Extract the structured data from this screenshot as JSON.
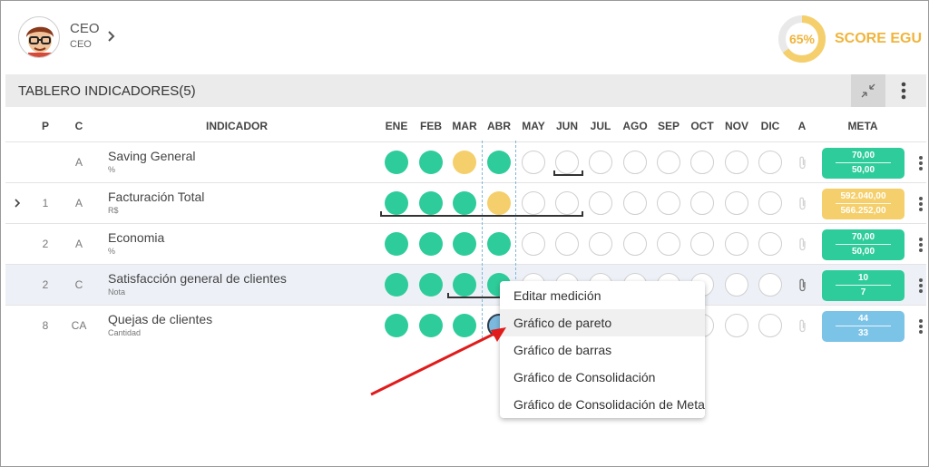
{
  "header": {
    "user_name": "CEO",
    "user_role": "CEO",
    "score_percent": "65%",
    "score_label": "SCORE EGU",
    "score_value": 0.65
  },
  "board": {
    "title": "TABLERO INDICADORES(5)",
    "columns": {
      "p": "P",
      "c": "C",
      "indicator": "INDICADOR",
      "months": [
        "ENE",
        "FEB",
        "MAR",
        "ABR",
        "MAY",
        "JUN",
        "JUL",
        "AGO",
        "SEP",
        "OCT",
        "NOV",
        "DIC"
      ],
      "a": "A",
      "meta": "META"
    },
    "rows": [
      {
        "p": "",
        "c": "A",
        "name": "Saving General",
        "unit": "%",
        "status": [
          "green",
          "green",
          "yellow",
          "green",
          "empty",
          "empty",
          "empty",
          "empty",
          "empty",
          "empty",
          "empty",
          "empty"
        ],
        "meta_top": "70,00",
        "meta_bottom": "50,00",
        "meta_color": "green"
      },
      {
        "p": "1",
        "c": "A",
        "name": "Facturación Total",
        "unit": "R$",
        "status": [
          "green",
          "green",
          "green",
          "yellow",
          "empty",
          "empty",
          "empty",
          "empty",
          "empty",
          "empty",
          "empty",
          "empty"
        ],
        "meta_top": "592.040,00",
        "meta_bottom": "566.252,00",
        "meta_color": "yellow"
      },
      {
        "p": "2",
        "c": "A",
        "name": "Economia",
        "unit": "%",
        "status": [
          "green",
          "green",
          "green",
          "green",
          "empty",
          "empty",
          "empty",
          "empty",
          "empty",
          "empty",
          "empty",
          "empty"
        ],
        "meta_top": "70,00",
        "meta_bottom": "50,00",
        "meta_color": "green"
      },
      {
        "p": "2",
        "c": "C",
        "name": "Satisfacción general de clientes",
        "unit": "Nota",
        "status": [
          "green",
          "green",
          "green",
          "green",
          "empty",
          "empty",
          "empty",
          "empty",
          "empty",
          "empty",
          "empty",
          "empty"
        ],
        "meta_top": "10",
        "meta_bottom": "7",
        "meta_color": "green"
      },
      {
        "p": "8",
        "c": "CA",
        "name": "Quejas de clientes",
        "unit": "Cantidad",
        "status": [
          "green",
          "green",
          "green",
          "blue",
          "empty",
          "empty",
          "empty",
          "empty",
          "empty",
          "empty",
          "empty",
          "empty"
        ],
        "meta_top": "44",
        "meta_bottom": "33",
        "meta_color": "blue"
      }
    ]
  },
  "context_menu": {
    "items": [
      "Editar medición",
      "Gráfico de pareto",
      "Gráfico de barras",
      "Gráfico de Consolidación",
      "Gráfico de Consolidación de Meta"
    ],
    "highlighted": "Gráfico de pareto"
  },
  "colors": {
    "green": "#2ecc9a",
    "yellow": "#f5cf6b",
    "blue": "#7cc3e8",
    "score": "#f0b43a",
    "arrow": "#e11b1b"
  }
}
